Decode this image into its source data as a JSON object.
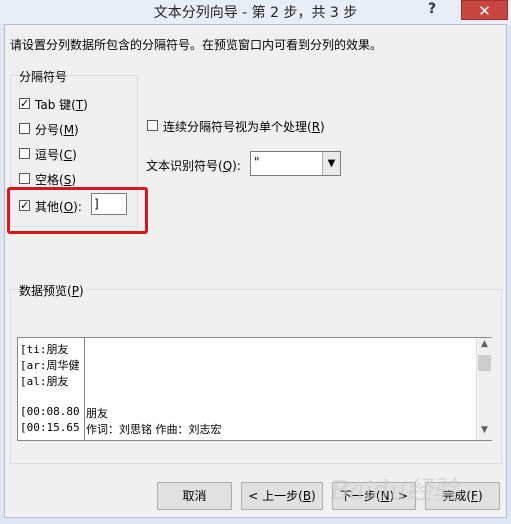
{
  "window": {
    "title": "文本分列向导 - 第 2 步，共 3 步",
    "help": "?",
    "close": "✕"
  },
  "instruction": "请设置分列数据所包含的分隔符号。在预览窗口内可看到分列的效果。",
  "delimiters": {
    "group_title": "分隔符号",
    "tab": {
      "label": "Tab 键(",
      "key": "T",
      "after": ")",
      "checked": "✓"
    },
    "semicolon": {
      "label": "分号(",
      "key": "M",
      "after": ")",
      "checked": ""
    },
    "comma": {
      "label": "逗号(",
      "key": "C",
      "after": ")",
      "checked": ""
    },
    "space": {
      "label": "空格(",
      "key": "S",
      "after": ")",
      "checked": ""
    },
    "other": {
      "label": "其他(",
      "key": "O",
      "after": "):",
      "checked": "✓",
      "value": "]"
    }
  },
  "consecutive": {
    "label": "连续分隔符号视为单个处理(",
    "key": "R",
    "after": ")",
    "checked": ""
  },
  "qualifier": {
    "label": "文本识别符号(",
    "key": "Q",
    "after": "):",
    "value": "\"",
    "dropdown_icon": "▼"
  },
  "preview": {
    "title": "数据预览(",
    "key": "P",
    "after": ")",
    "rows": [
      [
        "[ti:朋友",
        ""
      ],
      [
        "[ar:周华健",
        ""
      ],
      [
        "[al:朋友",
        ""
      ],
      [
        "",
        ""
      ],
      [
        "[00:08.80",
        "朋友"
      ],
      [
        "[00:15.65",
        "作词：刘思铭 作曲：刘志宏"
      ]
    ],
    "scroll_up": "▲",
    "scroll_down": "▼"
  },
  "buttons": {
    "cancel": "取消",
    "back": {
      "label": "< 上一步(",
      "key": "B",
      "after": ")"
    },
    "next": {
      "label": "下一步(",
      "key": "N",
      "after": ") >"
    },
    "finish": {
      "label": "完成(",
      "key": "F",
      "after": ")"
    }
  },
  "watermark": "Baidu经验"
}
